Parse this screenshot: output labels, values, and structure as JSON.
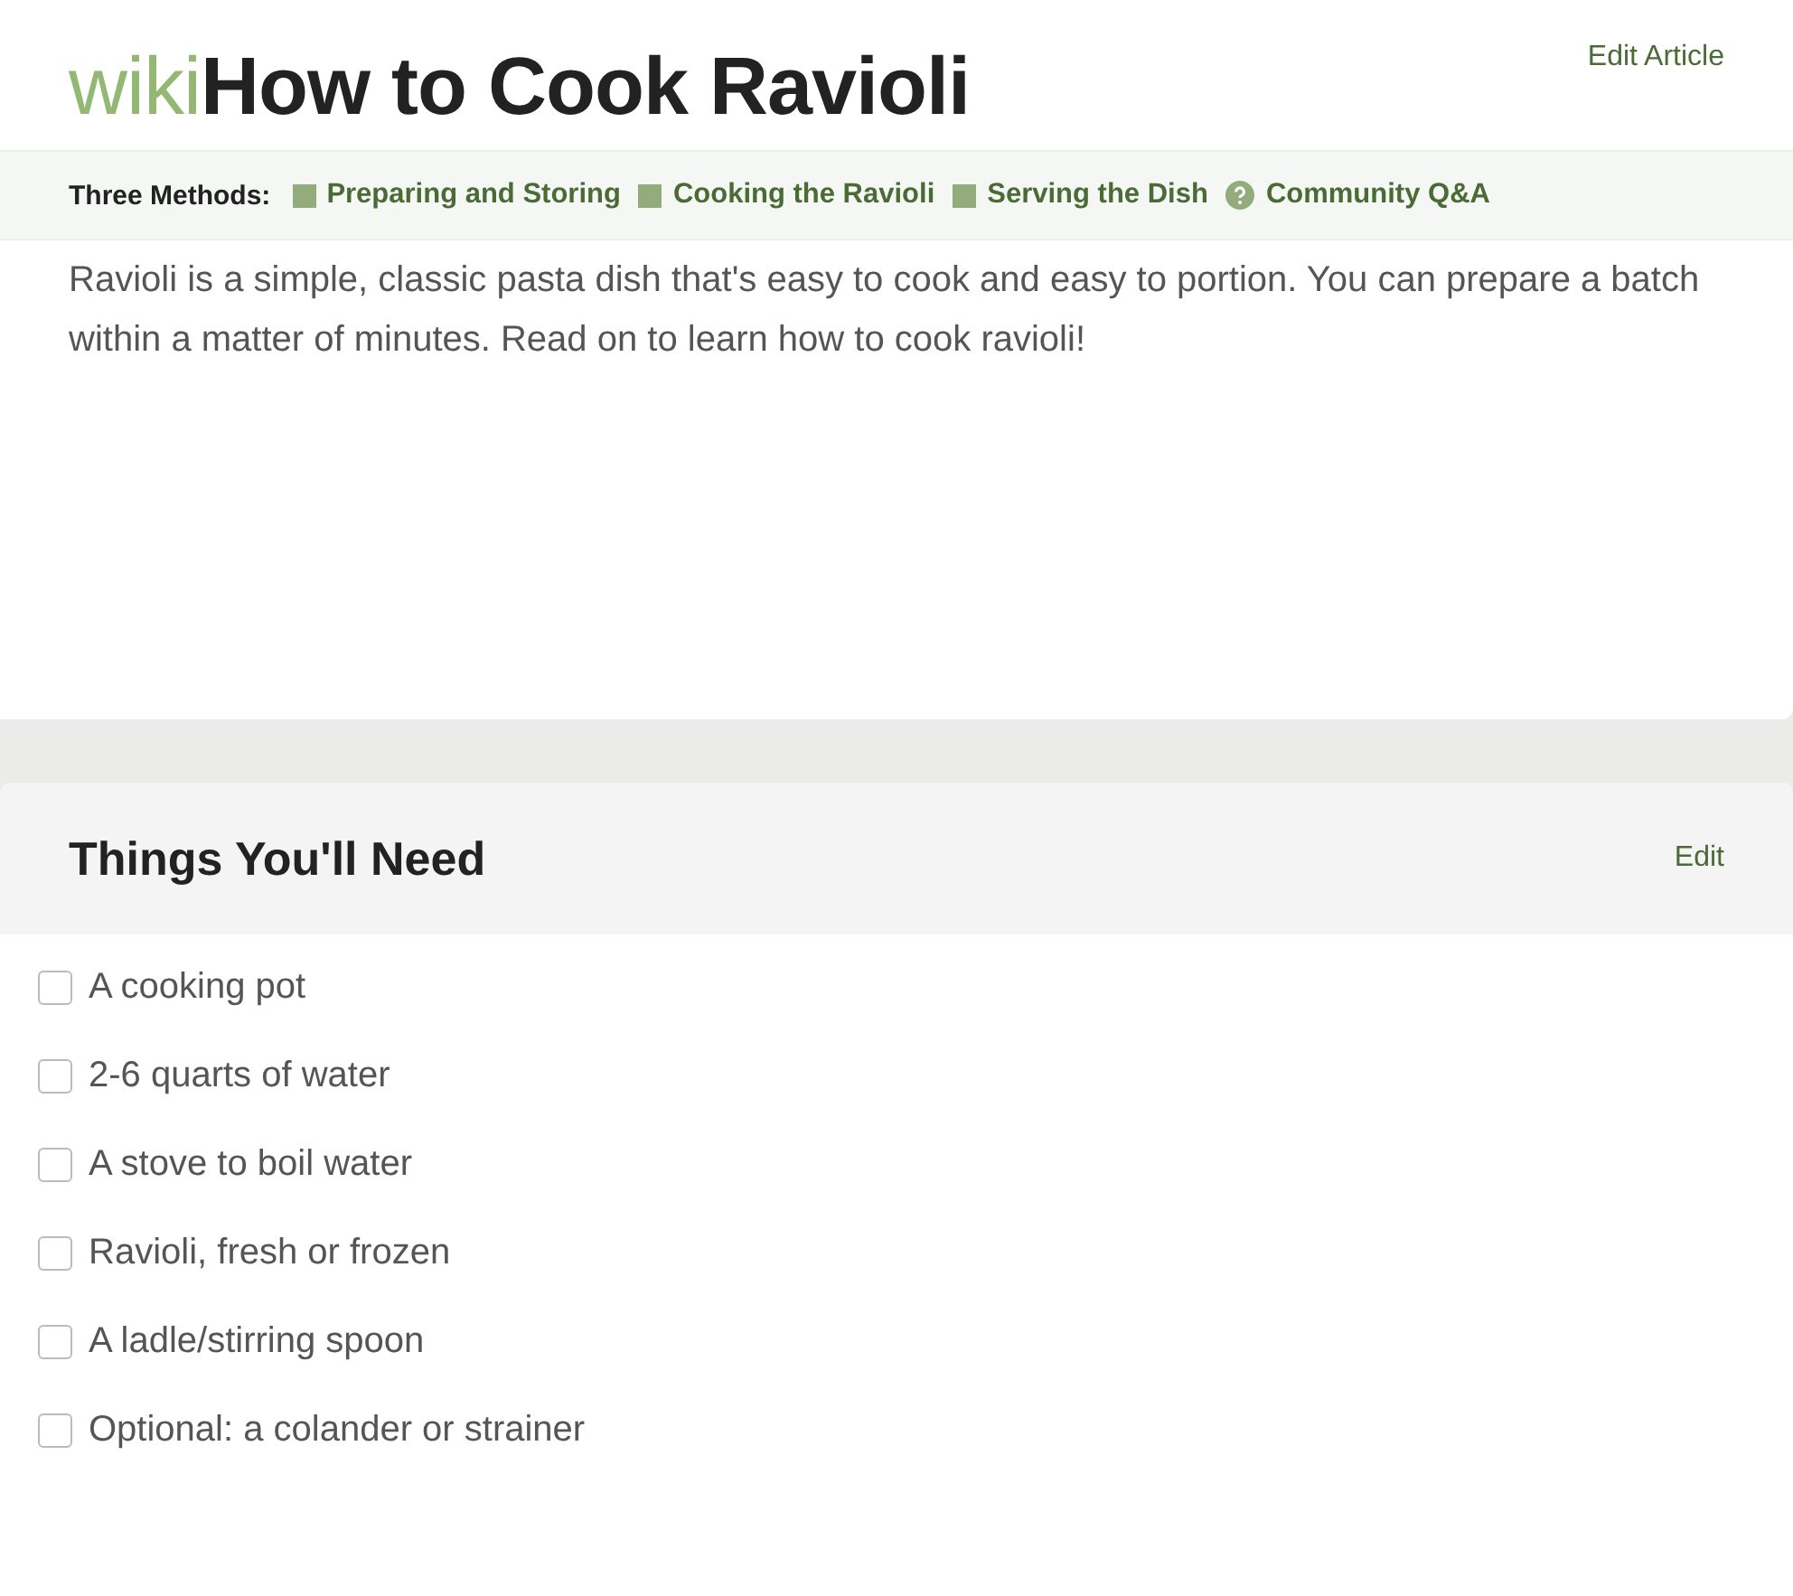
{
  "article": {
    "brand": "wiki",
    "title": "How to Cook Ravioli",
    "edit_link": "Edit Article",
    "methods_label": "Three Methods:",
    "methods": [
      {
        "kind": "section",
        "label": "Preparing and Storing"
      },
      {
        "kind": "section",
        "label": "Cooking the Ravioli"
      },
      {
        "kind": "section",
        "label": "Serving the Dish"
      },
      {
        "kind": "qa",
        "label": "Community Q&A"
      }
    ],
    "intro": "Ravioli is a simple, classic pasta dish that's easy to cook and easy to portion. You can prepare a batch within a matter of minutes. Read on to learn how to cook ravioli!"
  },
  "things": {
    "heading": "Things You'll Need",
    "edit_link": "Edit",
    "items": [
      {
        "label": "A cooking pot",
        "checked": false
      },
      {
        "label": "2-6 quarts of water",
        "checked": false
      },
      {
        "label": "A stove to boil water",
        "checked": false
      },
      {
        "label": "Ravioli, fresh or frozen",
        "checked": false
      },
      {
        "label": "A ladle/stirring spoon",
        "checked": false
      },
      {
        "label": "Optional: a colander or strainer",
        "checked": false
      }
    ]
  }
}
